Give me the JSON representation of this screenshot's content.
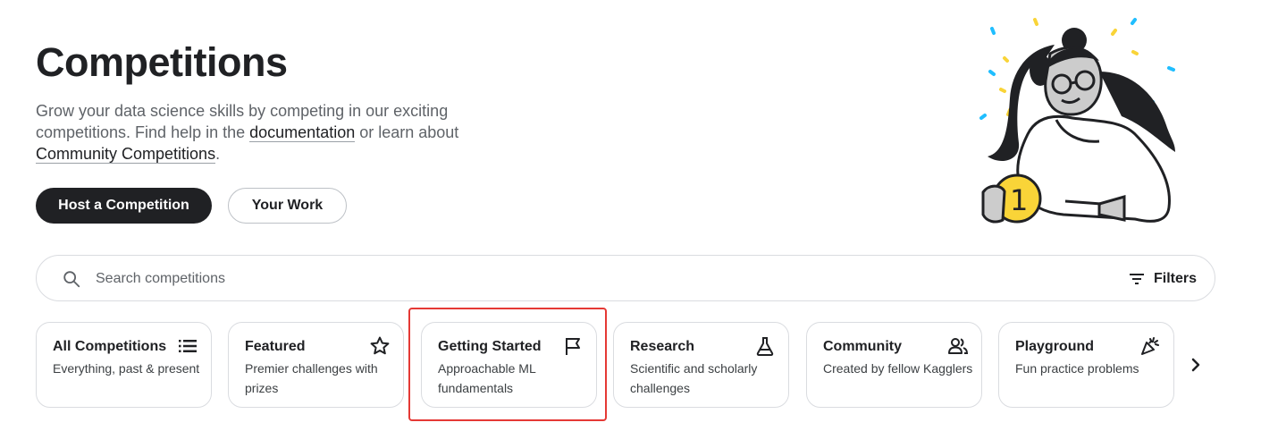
{
  "header": {
    "title": "Competitions",
    "intro_before": "Grow your data science skills by competing in our exciting competitions. Find help in the ",
    "documentation_link": "documentation",
    "intro_middle": " or learn about ",
    "community_link": "Community Competitions",
    "intro_end": "."
  },
  "actions": {
    "host_label": "Host a Competition",
    "work_label": "Your Work"
  },
  "search": {
    "placeholder": "Search competitions",
    "filters_label": "Filters"
  },
  "categories": [
    {
      "title": "All Competitions",
      "desc": "Everything, past & present",
      "icon": "list-icon"
    },
    {
      "title": "Featured",
      "desc": "Premier challenges with prizes",
      "icon": "star-icon"
    },
    {
      "title": "Getting Started",
      "desc": "Approachable ML fundamentals",
      "icon": "flag-icon"
    },
    {
      "title": "Research",
      "desc": "Scientific and scholarly challenges",
      "icon": "flask-icon"
    },
    {
      "title": "Community",
      "desc": "Created by fellow Kagglers",
      "icon": "people-icon"
    },
    {
      "title": "Playground",
      "desc": "Fun practice problems",
      "icon": "party-popper-icon"
    }
  ],
  "illustration": {
    "coin_text": "1",
    "icon": "person-holding-coin-illustration"
  },
  "colors": {
    "primary": "#202124",
    "secondary_text": "#5f6368",
    "border": "#dadce0",
    "highlight": "#e53935",
    "coin": "#f9d438",
    "confetti_blue": "#20beff"
  }
}
